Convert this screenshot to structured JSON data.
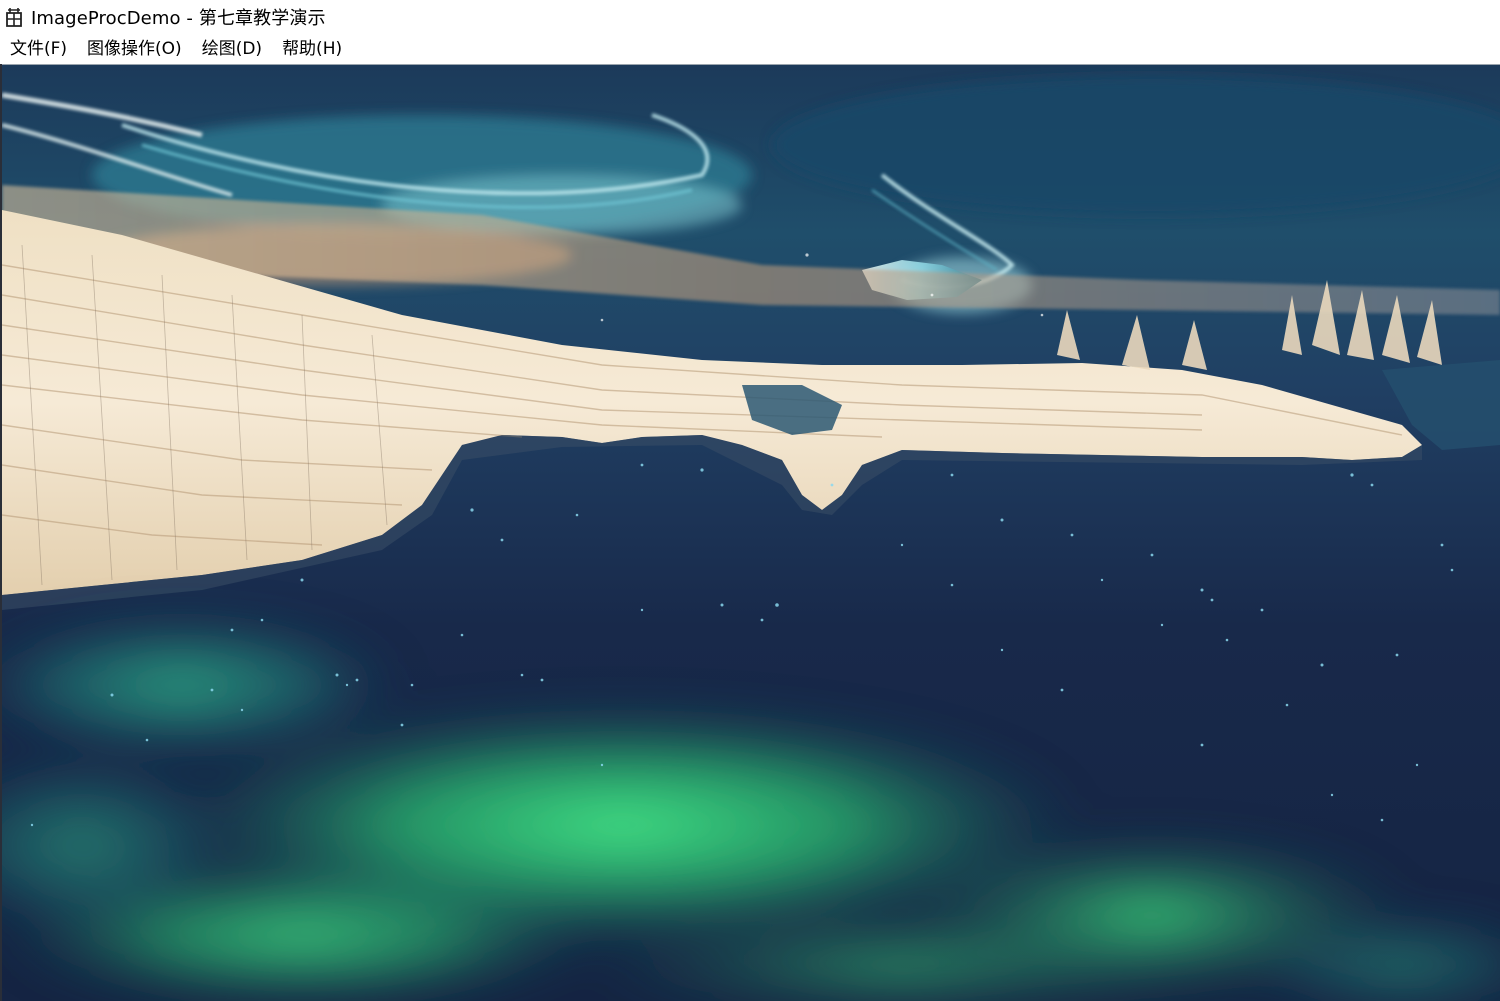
{
  "window": {
    "title": "ImageProcDemo - 第七章教学演示",
    "icon": "app-window-icon"
  },
  "menu": {
    "items": [
      {
        "label": "文件(F)"
      },
      {
        "label": "图像操作(O)"
      },
      {
        "label": "绘图(D)"
      },
      {
        "label": "帮助(H)"
      }
    ]
  },
  "canvas": {
    "content": "fractal-landscape-render",
    "colors": {
      "sky_dark": "#17294a",
      "deep_navy": "#1a2c4c",
      "teal": "#2a7f86",
      "aurora_green": "#3de07a",
      "cliff_cream": "#f3e6cf",
      "cliff_tan": "#d9b98f",
      "ice_cyan": "#8fd6e3"
    }
  }
}
